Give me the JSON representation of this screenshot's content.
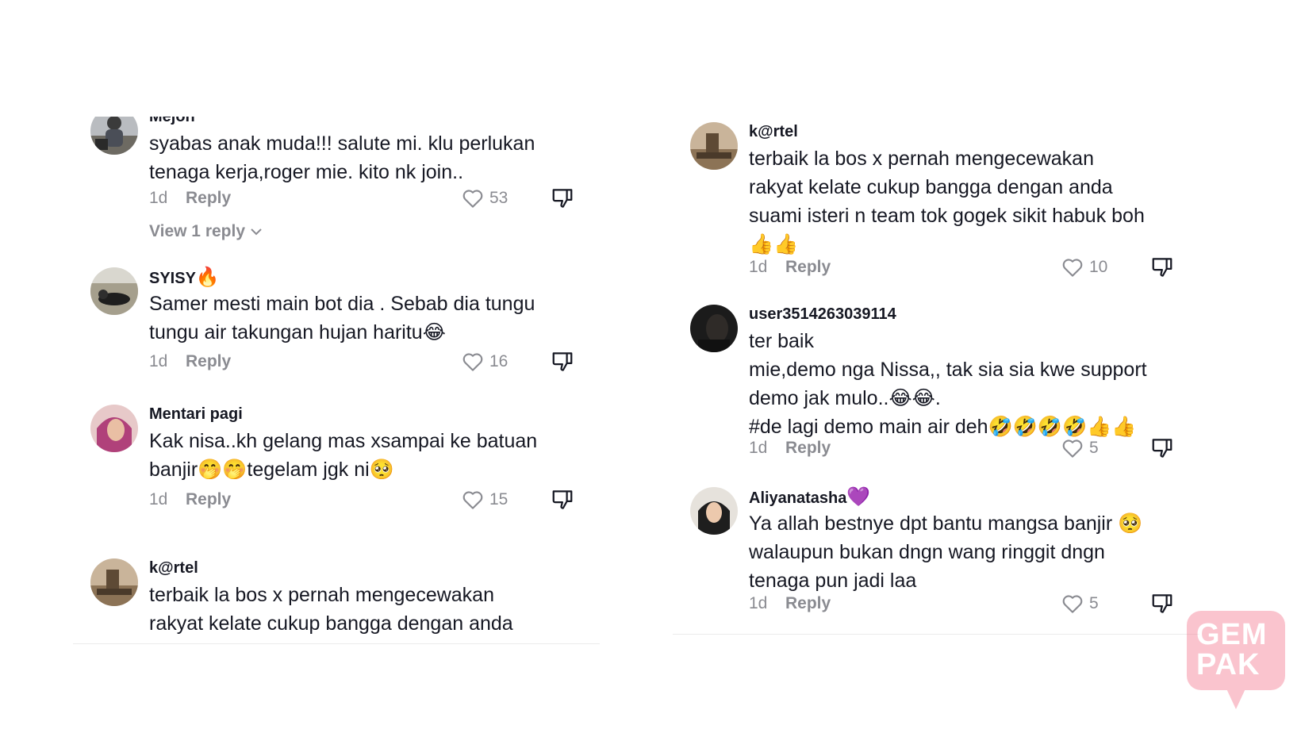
{
  "left_comments": [
    {
      "username": "Mejon",
      "lines": [
        "syabas anak muda!!! salute mi. klu perlukan",
        "tenaga kerja,roger mie. kito nk join.."
      ],
      "time": "1d",
      "reply": "Reply",
      "likes": "53",
      "view_replies": "View 1 reply"
    },
    {
      "username": "SYISY",
      "username_emoji": "🔥",
      "lines": [
        "Samer mesti main bot dia . Sebab dia tungu",
        "tungu air takungan hujan haritu😂"
      ],
      "time": "1d",
      "reply": "Reply",
      "likes": "16"
    },
    {
      "username": "Mentari pagi",
      "lines": [
        "Kak nisa..kh gelang mas xsampai ke batuan",
        "banjir🤭🤭tegelam jgk ni🥺"
      ],
      "time": "1d",
      "reply": "Reply",
      "likes": "15"
    },
    {
      "username": "k@rtel",
      "lines": [
        "terbaik la bos x pernah mengecewakan",
        "rakyat kelate cukup bangga dengan anda"
      ]
    }
  ],
  "right_comments": [
    {
      "username": "k@rtel",
      "lines": [
        "terbaik la bos x pernah mengecewakan",
        "rakyat kelate cukup bangga dengan anda",
        "suami isteri n team tok gogek sikit habuk boh",
        "👍👍"
      ],
      "time": "1d",
      "reply": "Reply",
      "likes": "10"
    },
    {
      "username": "user3514263039114",
      "lines": [
        "ter baik",
        "mie,demo nga Nissa,, tak sia sia kwe support",
        "demo jak mulo..😂😂.",
        "#de lagi demo main air deh🤣🤣🤣🤣👍👍"
      ],
      "time": "1d",
      "reply": "Reply",
      "likes": "5"
    },
    {
      "username": "Aliyanatasha",
      "username_emoji": "💜",
      "lines": [
        "Ya allah bestnye dpt bantu mangsa banjir 🥺",
        "walaupun bukan dngn wang ringgit dngn",
        "tenaga pun jadi laa"
      ],
      "time": "1d",
      "reply": "Reply",
      "likes": "5"
    }
  ],
  "watermark": {
    "line1": "GEM",
    "line2": "PAK"
  },
  "colors": {
    "text": "#161823",
    "muted": "#8a8b91",
    "watermark": "#f3657f"
  }
}
